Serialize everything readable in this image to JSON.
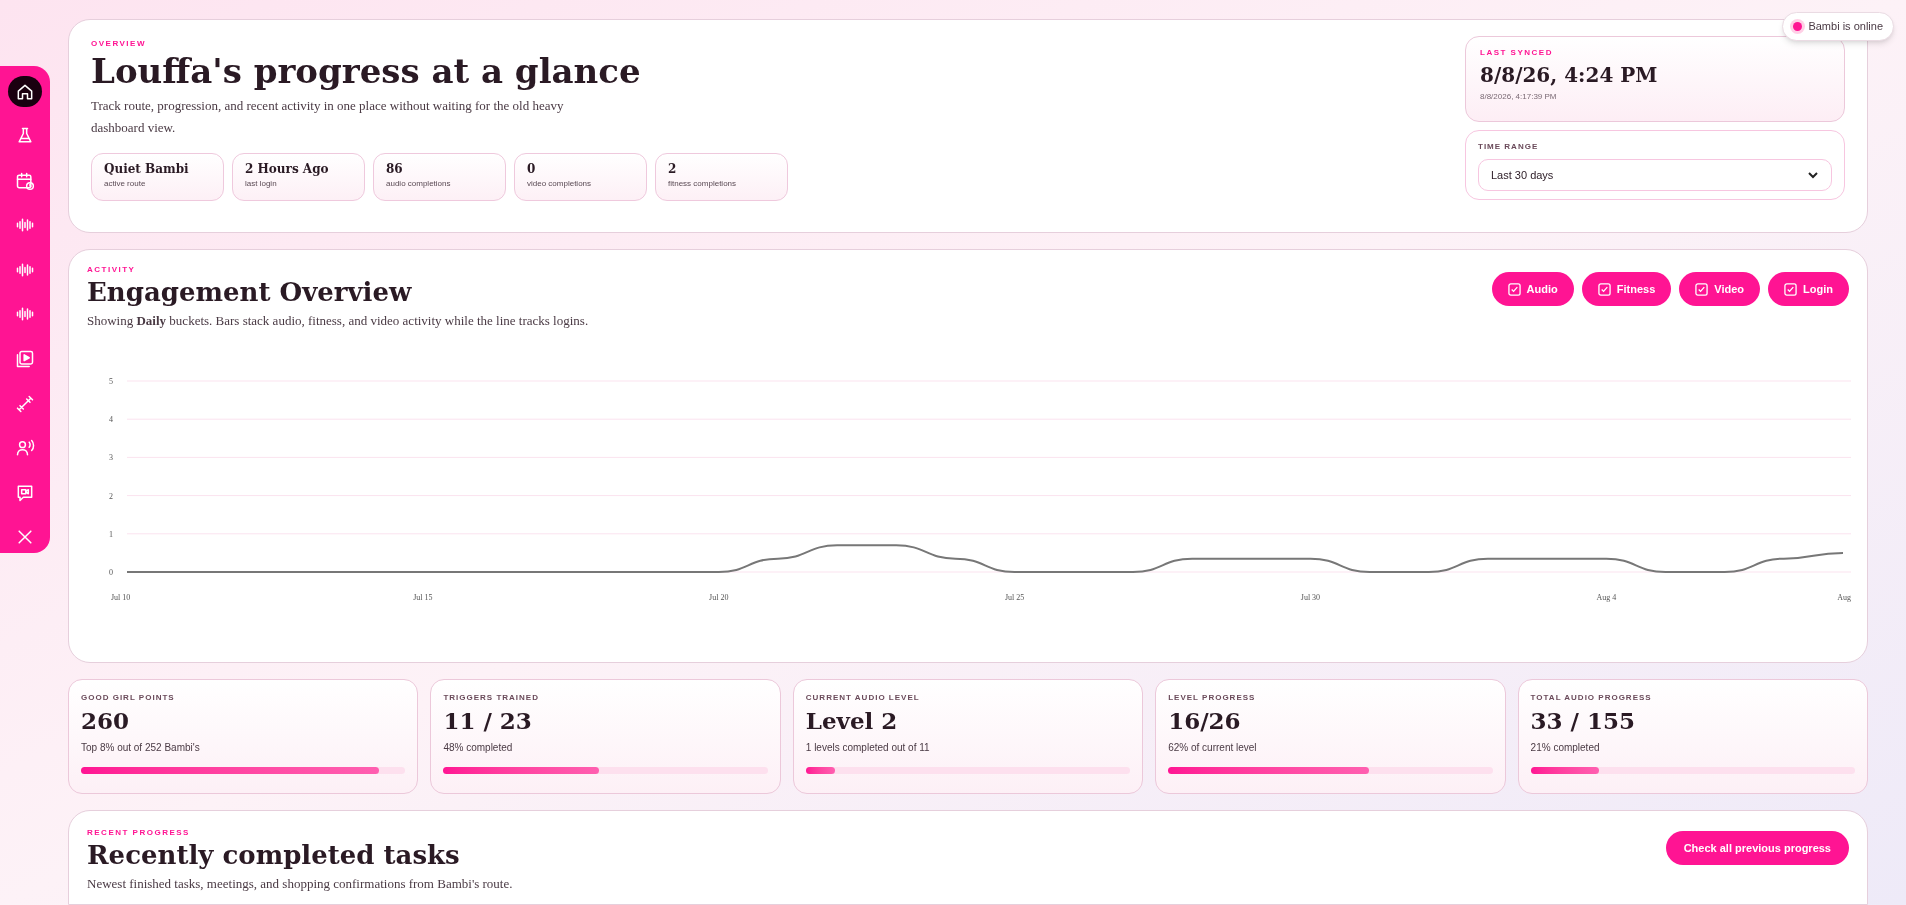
{
  "sidebar": {
    "items": [
      {
        "selected": true
      },
      {
        "selected": false
      },
      {
        "selected": false
      },
      {
        "selected": false
      },
      {
        "selected": false
      },
      {
        "selected": false
      },
      {
        "selected": false
      },
      {
        "selected": false
      },
      {
        "selected": false
      },
      {
        "selected": false
      },
      {
        "selected": false
      }
    ]
  },
  "presence": {
    "label": "Bambi is online",
    "color": "#ff1493"
  },
  "overview": {
    "eyebrow": "OVERVIEW",
    "title": "Louffa's progress at a glance",
    "description": "Track route, progression, and recent activity in one place without waiting for the old heavy dashboard view.",
    "stats": [
      {
        "value": "Quiet Bambi",
        "label": "active route"
      },
      {
        "value": "2 Hours Ago",
        "label": "last login"
      },
      {
        "value": "86",
        "label": "audio completions"
      },
      {
        "value": "0",
        "label": "video completions"
      },
      {
        "value": "2",
        "label": "fitness completions"
      }
    ],
    "last_synced": {
      "label": "LAST SYNCED",
      "value": "8/8/26, 4:24 PM",
      "detail": "8/8/2026, 4:17:39 PM"
    },
    "time_range": {
      "label": "TIME RANGE",
      "value": "Last 30 days"
    }
  },
  "engagement": {
    "eyebrow": "ACTIVITY",
    "title": "Engagement Overview",
    "description": "Showing **Daily** buckets. Bars stack audio, fitness, and video activity while the line tracks logins.",
    "toggles": [
      {
        "label": "Audio",
        "checked": true
      },
      {
        "label": "Fitness",
        "checked": true
      },
      {
        "label": "Video",
        "checked": true
      },
      {
        "label": "Login",
        "checked": true
      }
    ],
    "chart_data": {
      "type": "line",
      "categories": [
        "Jul 10",
        null,
        null,
        null,
        null,
        "Jul 15",
        null,
        null,
        null,
        null,
        "Jul 20",
        null,
        null,
        null,
        null,
        "Jul 25",
        null,
        null,
        null,
        null,
        "Jul 30",
        null,
        null,
        null,
        null,
        "Aug 4",
        null,
        null,
        null,
        "Aug"
      ],
      "ylim": [
        0,
        5
      ],
      "grid": true,
      "yticks": [
        0,
        1,
        2,
        3,
        4,
        5
      ],
      "series": [
        {
          "color": "#777777",
          "values": [
            0,
            0,
            0,
            0,
            0,
            0,
            0,
            0,
            0,
            0,
            0,
            0.35,
            0.7,
            0.7,
            0.35,
            0,
            0,
            0,
            0.35,
            0.35,
            0.35,
            0,
            0,
            0.35,
            0.35,
            0.35,
            0,
            0,
            0.35,
            0.5
          ]
        }
      ]
    }
  },
  "metrics": [
    {
      "label": "GOOD GIRL POINTS",
      "value": "260",
      "detail": "Top 8% out of 252 Bambi's",
      "level": 0.92
    },
    {
      "label": "TRIGGERS TRAINED",
      "value": "11 / 23",
      "detail": "48% completed",
      "level": 0.48
    },
    {
      "label": "CURRENT AUDIO LEVEL",
      "value": "Level 2",
      "detail": "1 levels completed out of 11",
      "level": 0.09
    },
    {
      "label": "LEVEL PROGRESS",
      "value": "16/26",
      "detail": "62% of current level",
      "level": 0.62
    },
    {
      "label": "TOTAL AUDIO PROGRESS",
      "value": "33 / 155",
      "detail": "21% completed",
      "level": 0.21
    }
  ],
  "recent": {
    "eyebrow": "RECENT PROGRESS",
    "title": "Recently completed tasks",
    "description": "Newest finished tasks, meetings, and shopping confirmations from Bambi's route.",
    "button": "Check all previous progress"
  }
}
